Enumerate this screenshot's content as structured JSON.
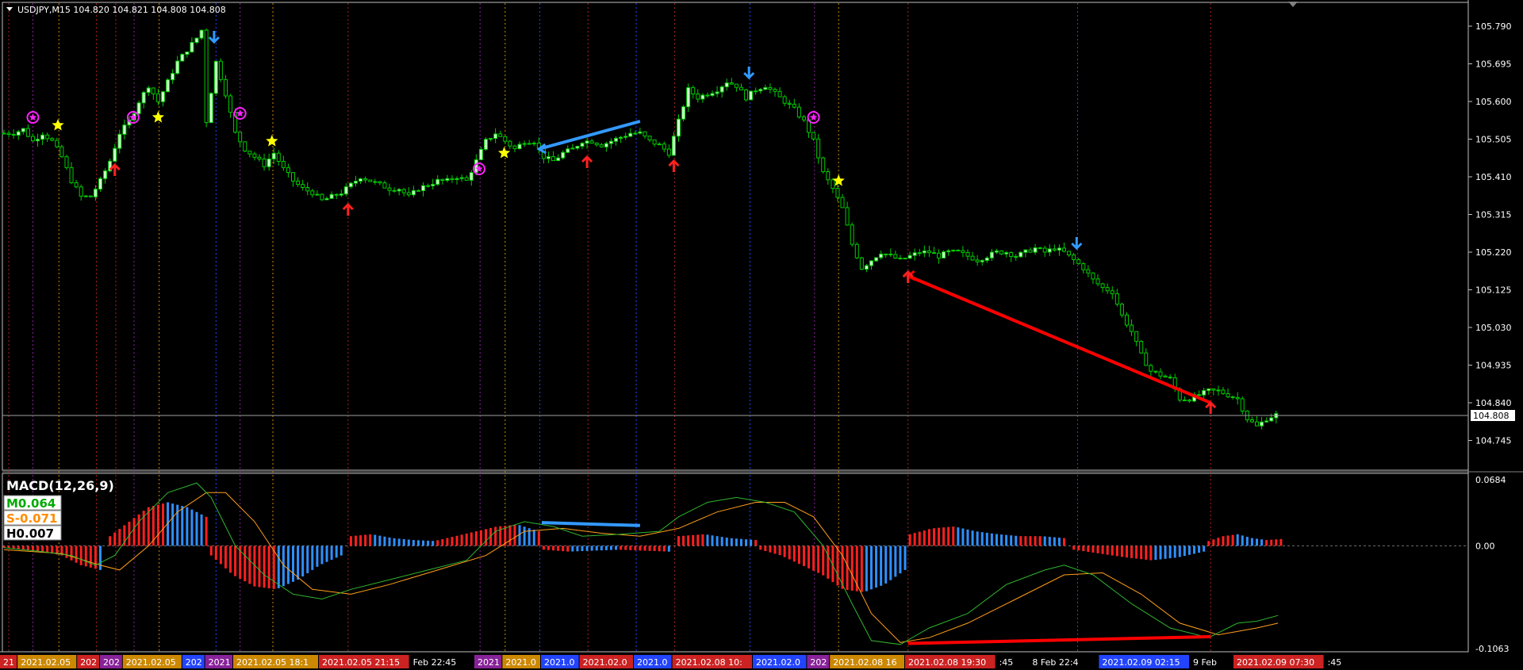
{
  "colors": {
    "background": "#000000",
    "bull_candle": "#ccffcc",
    "bear_candle": "#000000",
    "wick": "#00cc00",
    "grid_text": "#ffffff",
    "macd_line": "#2fb52f",
    "signal_line": "#ff9f1a",
    "hist_pos_up": "#ff2020",
    "hist_pos_down": "#2f8fff",
    "divergence_up": "#ff0000",
    "divergence_down": "#3399ff",
    "arrow_up": "#ff2020",
    "arrow_down": "#3399ff",
    "star_yellow": "#ffff00",
    "star_magenta": "#ff22ff"
  },
  "header": {
    "symbol_info": "USDJPY,M15  104.820 104.821 104.808 104.808"
  },
  "price_axis": {
    "ticks": [
      "105.790",
      "105.695",
      "105.600",
      "105.505",
      "105.410",
      "105.315",
      "105.220",
      "105.125",
      "105.030",
      "104.935",
      "104.840",
      "104.745"
    ],
    "current_price_label": "104.808"
  },
  "macd_panel": {
    "title": "MACD(12,26,9)",
    "m_label": "M0.064",
    "s_label": "S-0.071",
    "h_label": "H0.007",
    "ticks": [
      "0.0684",
      "0.00",
      "-0.1063"
    ]
  },
  "time_axis": {
    "labels": [
      {
        "text": "21",
        "color": "#cc2222"
      },
      {
        "text": "2021.02.05",
        "color": "#cc8800"
      },
      {
        "text": "202",
        "color": "#cc2222"
      },
      {
        "text": "202",
        "color": "#882299"
      },
      {
        "text": "2021.02.05",
        "color": "#cc8800"
      },
      {
        "text": "202",
        "color": "#2244ff"
      },
      {
        "text": "2021",
        "color": "#882299"
      },
      {
        "text": "2021.02.05 18:1",
        "color": "#cc8800"
      },
      {
        "text": "2021.02.05 21:15",
        "color": "#cc2222"
      },
      {
        "text": "Feb 22:45",
        "color": ""
      },
      {
        "text": "2021",
        "color": "#882299"
      },
      {
        "text": "2021.0",
        "color": "#cc8800"
      },
      {
        "text": "2021.0",
        "color": "#2244ff"
      },
      {
        "text": "2021.02.0",
        "color": "#cc2222"
      },
      {
        "text": "2021.0",
        "color": "#2244ff"
      },
      {
        "text": "2021.02.08 10:",
        "color": "#cc2222"
      },
      {
        "text": "2021.02.0",
        "color": "#2244ff"
      },
      {
        "text": "202",
        "color": "#882299"
      },
      {
        "text": "2021.02.08 16",
        "color": "#cc8800"
      },
      {
        "text": "2021.02.08 19:30",
        "color": "#cc2222"
      },
      {
        "text": ":45",
        "color": ""
      },
      {
        "text": "8 Feb 22:4",
        "color": ""
      },
      {
        "text": "2021.02.09 02:15",
        "color": "#2244ff"
      },
      {
        "text": "9 Feb",
        "color": ""
      },
      {
        "text": "2021.02.09 07:30",
        "color": "#cc2222"
      },
      {
        "text": ":45",
        "color": ""
      }
    ]
  },
  "chart_data": {
    "type": "candlestick",
    "symbol": "USDJPY",
    "timeframe": "M15",
    "ylim": [
      104.7,
      105.82
    ],
    "current_price": 104.808,
    "close_path": [
      [
        0,
        105.52
      ],
      [
        10,
        105.52
      ],
      [
        20,
        105.53
      ],
      [
        30,
        105.5
      ],
      [
        40,
        105.52
      ],
      [
        50,
        105.5
      ],
      [
        60,
        105.46
      ],
      [
        70,
        105.4
      ],
      [
        80,
        105.36
      ],
      [
        90,
        105.36
      ],
      [
        100,
        105.4
      ],
      [
        110,
        105.45
      ],
      [
        120,
        105.52
      ],
      [
        130,
        105.55
      ],
      [
        140,
        105.6
      ],
      [
        150,
        105.64
      ],
      [
        160,
        105.6
      ],
      [
        170,
        105.65
      ],
      [
        180,
        105.7
      ],
      [
        190,
        105.73
      ],
      [
        200,
        105.76
      ],
      [
        205,
        105.78
      ],
      [
        210,
        105.55
      ],
      [
        220,
        105.7
      ],
      [
        230,
        105.62
      ],
      [
        240,
        105.52
      ],
      [
        250,
        105.48
      ],
      [
        260,
        105.46
      ],
      [
        270,
        105.44
      ],
      [
        280,
        105.47
      ],
      [
        290,
        105.43
      ],
      [
        300,
        105.4
      ],
      [
        310,
        105.38
      ],
      [
        320,
        105.37
      ],
      [
        330,
        105.35
      ],
      [
        340,
        105.36
      ],
      [
        350,
        105.37
      ],
      [
        360,
        105.39
      ],
      [
        370,
        105.41
      ],
      [
        380,
        105.4
      ],
      [
        390,
        105.39
      ],
      [
        400,
        105.38
      ],
      [
        410,
        105.38
      ],
      [
        420,
        105.36
      ],
      [
        430,
        105.38
      ],
      [
        440,
        105.39
      ],
      [
        450,
        105.4
      ],
      [
        460,
        105.4
      ],
      [
        470,
        105.41
      ],
      [
        480,
        105.4
      ],
      [
        490,
        105.45
      ],
      [
        500,
        105.5
      ],
      [
        510,
        105.52
      ],
      [
        520,
        105.5
      ],
      [
        530,
        105.48
      ],
      [
        540,
        105.5
      ],
      [
        550,
        105.5
      ],
      [
        560,
        105.46
      ],
      [
        570,
        105.45
      ],
      [
        580,
        105.47
      ],
      [
        590,
        105.48
      ],
      [
        600,
        105.5
      ],
      [
        610,
        105.5
      ],
      [
        620,
        105.49
      ],
      [
        630,
        105.5
      ],
      [
        640,
        105.51
      ],
      [
        650,
        105.52
      ],
      [
        660,
        105.52
      ],
      [
        670,
        105.5
      ],
      [
        680,
        105.49
      ],
      [
        690,
        105.47
      ],
      [
        700,
        105.55
      ],
      [
        710,
        105.63
      ],
      [
        720,
        105.61
      ],
      [
        730,
        105.62
      ],
      [
        740,
        105.63
      ],
      [
        750,
        105.65
      ],
      [
        760,
        105.64
      ],
      [
        770,
        105.61
      ],
      [
        780,
        105.63
      ],
      [
        790,
        105.64
      ],
      [
        800,
        105.62
      ],
      [
        810,
        105.6
      ],
      [
        820,
        105.58
      ],
      [
        830,
        105.55
      ],
      [
        840,
        105.5
      ],
      [
        850,
        105.42
      ],
      [
        860,
        105.38
      ],
      [
        870,
        105.33
      ],
      [
        880,
        105.24
      ],
      [
        890,
        105.18
      ],
      [
        900,
        105.2
      ],
      [
        910,
        105.22
      ],
      [
        920,
        105.21
      ],
      [
        930,
        105.2
      ],
      [
        940,
        105.21
      ],
      [
        950,
        105.22
      ],
      [
        960,
        105.22
      ],
      [
        970,
        105.21
      ],
      [
        980,
        105.22
      ],
      [
        990,
        105.22
      ],
      [
        1000,
        105.21
      ],
      [
        1010,
        105.2
      ],
      [
        1020,
        105.21
      ],
      [
        1030,
        105.22
      ],
      [
        1040,
        105.22
      ],
      [
        1050,
        105.21
      ],
      [
        1060,
        105.22
      ],
      [
        1070,
        105.23
      ],
      [
        1080,
        105.22
      ],
      [
        1090,
        105.23
      ],
      [
        1100,
        105.22
      ],
      [
        1110,
        105.2
      ],
      [
        1120,
        105.18
      ],
      [
        1130,
        105.15
      ],
      [
        1140,
        105.13
      ],
      [
        1150,
        105.12
      ],
      [
        1160,
        105.06
      ],
      [
        1170,
        105.02
      ],
      [
        1180,
        104.96
      ],
      [
        1190,
        104.92
      ],
      [
        1200,
        104.91
      ],
      [
        1210,
        104.9
      ],
      [
        1220,
        104.85
      ],
      [
        1230,
        104.85
      ],
      [
        1240,
        104.86
      ],
      [
        1250,
        104.87
      ],
      [
        1260,
        104.87
      ],
      [
        1270,
        104.86
      ],
      [
        1280,
        104.85
      ],
      [
        1290,
        104.8
      ],
      [
        1300,
        104.78
      ],
      [
        1310,
        104.8
      ],
      [
        1320,
        104.81
      ]
    ],
    "markers": [
      {
        "type": "arrow-up",
        "x": 115,
        "price": 105.44
      },
      {
        "type": "arrow-down",
        "x": 218,
        "price": 105.75
      },
      {
        "type": "arrow-up",
        "x": 357,
        "price": 105.34
      },
      {
        "type": "arrow-up",
        "x": 605,
        "price": 105.46
      },
      {
        "type": "arrow-up",
        "x": 695,
        "price": 105.45
      },
      {
        "type": "arrow-down",
        "x": 773,
        "price": 105.66
      },
      {
        "type": "arrow-up",
        "x": 938,
        "price": 105.17
      },
      {
        "type": "arrow-down",
        "x": 1113,
        "price": 105.23
      },
      {
        "type": "arrow-up",
        "x": 1252,
        "price": 104.84
      },
      {
        "type": "star-magenta",
        "x": 30,
        "price": 105.56
      },
      {
        "type": "star-magenta",
        "x": 134,
        "price": 105.56
      },
      {
        "type": "star-magenta",
        "x": 245,
        "price": 105.57
      },
      {
        "type": "star-magenta",
        "x": 493,
        "price": 105.43
      },
      {
        "type": "star-magenta",
        "x": 840,
        "price": 105.56
      },
      {
        "type": "star-yellow",
        "x": 56,
        "price": 105.54
      },
      {
        "type": "star-yellow",
        "x": 160,
        "price": 105.56
      },
      {
        "type": "star-yellow",
        "x": 278,
        "price": 105.5
      },
      {
        "type": "star-yellow",
        "x": 519,
        "price": 105.47
      },
      {
        "type": "star-yellow",
        "x": 866,
        "price": 105.4
      }
    ],
    "divergence_lines": [
      {
        "color": "blue",
        "from": [
          555,
          105.48
        ],
        "to": [
          660,
          105.55
        ]
      },
      {
        "color": "red",
        "from": [
          938,
          105.16
        ],
        "to": [
          1252,
          104.84
        ]
      }
    ],
    "vertical_markers": [
      {
        "x": 5,
        "color": "#aa2222"
      },
      {
        "x": 30,
        "color": "#882299"
      },
      {
        "x": 57,
        "color": "#cc8800"
      },
      {
        "x": 96,
        "color": "#aa2222"
      },
      {
        "x": 116,
        "color": "#aa2222"
      },
      {
        "x": 135,
        "color": "#882299"
      },
      {
        "x": 161,
        "color": "#cc8800"
      },
      {
        "x": 220,
        "color": "#2244ff"
      },
      {
        "x": 245,
        "color": "#882299"
      },
      {
        "x": 279,
        "color": "#cc8800"
      },
      {
        "x": 357,
        "color": "#aa2222"
      },
      {
        "x": 494,
        "color": "#882299"
      },
      {
        "x": 520,
        "color": "#cc8800"
      },
      {
        "x": 556,
        "color": "#2244ff"
      },
      {
        "x": 606,
        "color": "#aa2222"
      },
      {
        "x": 656,
        "color": "#2244ff"
      },
      {
        "x": 696,
        "color": "#aa2222"
      },
      {
        "x": 774,
        "color": "#2244ff"
      },
      {
        "x": 841,
        "color": "#882299"
      },
      {
        "x": 866,
        "color": "#cc8800"
      },
      {
        "x": 938,
        "color": "#aa2222"
      },
      {
        "x": 1114,
        "color": "#2244ff"
      },
      {
        "x": 1252,
        "color": "#aa2222"
      }
    ],
    "macd": {
      "ylim": [
        -0.1063,
        0.0684
      ],
      "macd_line": [
        [
          0,
          -0.002
        ],
        [
          40,
          -0.006
        ],
        [
          70,
          -0.01
        ],
        [
          95,
          -0.02
        ],
        [
          115,
          -0.01
        ],
        [
          140,
          0.025
        ],
        [
          170,
          0.055
        ],
        [
          200,
          0.065
        ],
        [
          215,
          0.05
        ],
        [
          240,
          0.0
        ],
        [
          270,
          -0.03
        ],
        [
          300,
          -0.05
        ],
        [
          330,
          -0.055
        ],
        [
          360,
          -0.045
        ],
        [
          400,
          -0.035
        ],
        [
          440,
          -0.025
        ],
        [
          480,
          -0.015
        ],
        [
          510,
          0.015
        ],
        [
          540,
          0.025
        ],
        [
          570,
          0.02
        ],
        [
          600,
          0.01
        ],
        [
          640,
          0.012
        ],
        [
          680,
          0.015
        ],
        [
          700,
          0.03
        ],
        [
          730,
          0.045
        ],
        [
          760,
          0.05
        ],
        [
          790,
          0.045
        ],
        [
          820,
          0.035
        ],
        [
          850,
          0.0
        ],
        [
          880,
          -0.06
        ],
        [
          900,
          -0.098
        ],
        [
          930,
          -0.102
        ],
        [
          960,
          -0.085
        ],
        [
          1000,
          -0.07
        ],
        [
          1040,
          -0.04
        ],
        [
          1080,
          -0.025
        ],
        [
          1100,
          -0.02
        ],
        [
          1130,
          -0.03
        ],
        [
          1170,
          -0.06
        ],
        [
          1210,
          -0.085
        ],
        [
          1250,
          -0.095
        ],
        [
          1280,
          -0.08
        ],
        [
          1300,
          -0.078
        ],
        [
          1322,
          -0.072
        ]
      ],
      "signal_line": [
        [
          0,
          -0.004
        ],
        [
          60,
          -0.008
        ],
        [
          100,
          -0.02
        ],
        [
          120,
          -0.025
        ],
        [
          150,
          0.0
        ],
        [
          180,
          0.035
        ],
        [
          210,
          0.055
        ],
        [
          230,
          0.055
        ],
        [
          260,
          0.025
        ],
        [
          290,
          -0.02
        ],
        [
          320,
          -0.045
        ],
        [
          360,
          -0.05
        ],
        [
          400,
          -0.04
        ],
        [
          450,
          -0.025
        ],
        [
          500,
          -0.01
        ],
        [
          540,
          0.015
        ],
        [
          580,
          0.018
        ],
        [
          620,
          0.013
        ],
        [
          660,
          0.01
        ],
        [
          700,
          0.018
        ],
        [
          740,
          0.035
        ],
        [
          780,
          0.045
        ],
        [
          810,
          0.045
        ],
        [
          840,
          0.03
        ],
        [
          870,
          -0.01
        ],
        [
          900,
          -0.07
        ],
        [
          930,
          -0.1
        ],
        [
          960,
          -0.095
        ],
        [
          1000,
          -0.08
        ],
        [
          1050,
          -0.055
        ],
        [
          1100,
          -0.03
        ],
        [
          1140,
          -0.028
        ],
        [
          1180,
          -0.05
        ],
        [
          1220,
          -0.08
        ],
        [
          1260,
          -0.092
        ],
        [
          1300,
          -0.085
        ],
        [
          1322,
          -0.08
        ]
      ],
      "histogram_segments": [
        {
          "from": 0,
          "to": 100,
          "values": [
            -0.002,
            -0.004,
            -0.006,
            -0.01,
            -0.02,
            -0.025
          ]
        },
        {
          "from": 110,
          "to": 210,
          "values": [
            0.01,
            0.025,
            0.04,
            0.045,
            0.04,
            0.03
          ]
        },
        {
          "from": 215,
          "to": 350,
          "values": [
            -0.01,
            -0.03,
            -0.042,
            -0.045,
            -0.035,
            -0.02,
            -0.01
          ]
        },
        {
          "from": 360,
          "to": 555,
          "values": [
            0.01,
            0.012,
            0.008,
            0.006,
            0.005,
            0.01,
            0.015,
            0.02,
            0.022,
            0.015
          ]
        },
        {
          "from": 560,
          "to": 690,
          "values": [
            -0.004,
            -0.006,
            -0.005,
            -0.004,
            -0.005,
            -0.006
          ]
        },
        {
          "from": 700,
          "to": 780,
          "values": [
            0.01,
            0.012,
            0.008,
            0.006
          ]
        },
        {
          "from": 785,
          "to": 935,
          "values": [
            -0.004,
            -0.01,
            -0.02,
            -0.03,
            -0.045,
            -0.048,
            -0.04,
            -0.025
          ]
        },
        {
          "from": 940,
          "to": 1100,
          "values": [
            0.012,
            0.018,
            0.02,
            0.015,
            0.012,
            0.01,
            0.01,
            0.008
          ]
        },
        {
          "from": 1110,
          "to": 1245,
          "values": [
            -0.004,
            -0.008,
            -0.012,
            -0.015,
            -0.012,
            -0.006
          ]
        },
        {
          "from": 1250,
          "to": 1325,
          "values": [
            0.005,
            0.01,
            0.012,
            0.008,
            0.006,
            0.007
          ]
        }
      ],
      "divergence_lines": [
        {
          "color": "blue",
          "from": [
            558,
            0.024
          ],
          "to": [
            660,
            0.021
          ]
        },
        {
          "color": "red",
          "from": [
            938,
            -0.101
          ],
          "to": [
            1252,
            -0.094
          ]
        }
      ]
    }
  }
}
